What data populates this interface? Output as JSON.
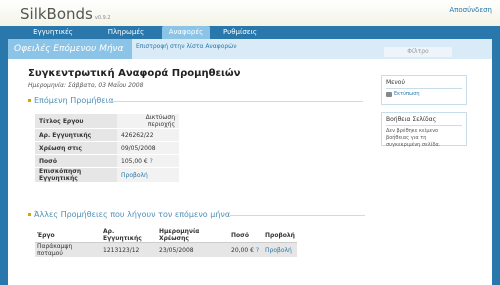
{
  "header": {
    "logo": "SilkBonds",
    "version": "v0.9.2",
    "logout": "Αποσύνδεση"
  },
  "nav": {
    "items": [
      {
        "label": "Εγγυητικές επιστολές"
      },
      {
        "label": "Πληρωμές"
      },
      {
        "label": "Αναφορές"
      },
      {
        "label": "Ρυθμίσεις"
      }
    ],
    "active_index": 2
  },
  "subheader": {
    "section_title": "Οφειλές Επόμενου Μήνα",
    "back_link": "Επιστροφή στην λίστα Αναφορών",
    "filter_label": "Φίλτρο"
  },
  "report": {
    "title": "Συγκεντρωτική Αναφορά Προμηθειών",
    "date_line": "Ημερομηνία: Σάββατο, 03 Μαΐου 2008",
    "next_commission_header": "Επόμενη Προμήθεια",
    "fields": [
      {
        "label": "Τίτλος Εργου",
        "value": "Δικτύωση περιοχής"
      },
      {
        "label": "Αρ. Εγγυητικής",
        "value": "426262/22"
      },
      {
        "label": "Χρέωση στις",
        "value": "09/05/2008"
      },
      {
        "label": "Ποσό",
        "value": "105,00 €",
        "help": "?"
      },
      {
        "label": "Επισκόπηση Εγγυητικής",
        "value": "Προβολή"
      }
    ],
    "other_header": "Άλλες Προμήθειες που λήγουν τον επόμενο μήνα",
    "other_columns": [
      "Έργο",
      "Αρ. Εγγυητικής",
      "Ημερομηνία Χρέωσης",
      "Ποσό",
      "Προβολή"
    ],
    "other_rows": [
      {
        "project": "Παράκαμψη ποταμού",
        "guarantee": "1213123/12",
        "date": "23/05/2008",
        "amount": "20,00 €",
        "help": "?",
        "view": "Προβολή"
      }
    ]
  },
  "sidebar": {
    "menu_title": "Μενού",
    "print_link": "Εκτύπωση",
    "help_title": "Βοήθεια Σελίδας",
    "help_text": "Δεν βρέθηκε κείμενο βοήθειας για τη συγκεκριμένη σελίδα."
  },
  "colors": {
    "brand_blue": "#2a78ab",
    "active_tab": "#8cc4e8",
    "accent_gold": "#d9a400"
  }
}
